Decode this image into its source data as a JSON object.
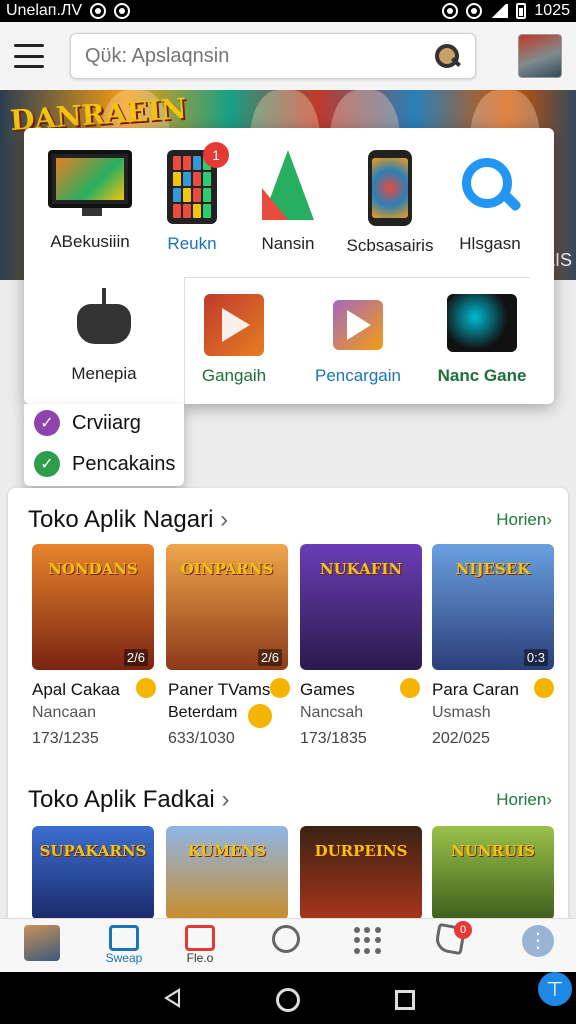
{
  "status_bar": {
    "carrier": "Unelaп.ЛV",
    "time": "1025"
  },
  "search": {
    "placeholder": "Qϋk: Apslaqnsin"
  },
  "banner": {
    "logo": "DANRAEIN",
    "side_text": "ΛIS"
  },
  "popup": {
    "items": [
      {
        "label": "ABekusiiin",
        "icon": "monitor-icon",
        "style": "normal"
      },
      {
        "label": "Reukn",
        "icon": "tablet-icon",
        "style": "blue",
        "badge": "1"
      },
      {
        "label": "Nansin",
        "icon": "triangle-logo-icon",
        "style": "normal"
      },
      {
        "label": "Scbsasairis",
        "icon": "phone-icon",
        "style": "normal"
      },
      {
        "label": "Hlsgasn",
        "icon": "search-icon",
        "style": "normal"
      },
      {
        "label": "Menepia",
        "icon": "gamepad-icon",
        "style": "normal"
      },
      {
        "label": "Gangaih",
        "icon": "play-store-icon",
        "style": "green"
      },
      {
        "label": "Pencargain",
        "icon": "play-gradient-icon",
        "style": "blue"
      },
      {
        "label": "Nanc Gane",
        "icon": "dark-game-icon",
        "style": "green"
      }
    ],
    "checks": [
      {
        "label": "Crviiarg",
        "color": "#8e44ad"
      },
      {
        "label": "Pencakains",
        "color": "#2e9d4a"
      }
    ]
  },
  "section1": {
    "title": "Toko Aplik Nagari",
    "link": "Horien",
    "apps": [
      {
        "tile_text": "NONDANS",
        "count": "2/6",
        "name": "Apal Cakaa",
        "sub": "Nancaan",
        "num": "173/1235",
        "bg": "#b9451d"
      },
      {
        "tile_text": "OINPARNS",
        "count": "2/6",
        "name": "Paner TVams",
        "sub": "Beterdam",
        "num": "633/1030",
        "bg": "#c0662a"
      },
      {
        "tile_text": "NUKAFIN",
        "count": "",
        "name": "Games",
        "sub": "Nancsah",
        "num": "173/1835",
        "bg": "#4a2a86"
      },
      {
        "tile_text": "NIJESEK",
        "count": "0:3",
        "name": "Para Caran",
        "sub": "Usmash",
        "num": "202/025",
        "bg": "#3f6cb3"
      }
    ]
  },
  "section2": {
    "title": "Toko Aplik Fadkai",
    "link": "Horien",
    "apps": [
      {
        "tile_text": "SUPAKARNS",
        "bg": "#2b4fa8"
      },
      {
        "tile_text": "KUMENS",
        "bg": "#d7a531"
      },
      {
        "tile_text": "DURPEINS",
        "bg": "#8b2a1a"
      },
      {
        "tile_text": "NUNRUIS",
        "bg": "#5c8a2a"
      }
    ]
  },
  "bottom_nav": [
    {
      "label": "",
      "icon": "game-avatar-icon"
    },
    {
      "label": "Sweap",
      "icon": "tv-icon"
    },
    {
      "label": "Fle.o",
      "icon": "video-icon"
    },
    {
      "label": "",
      "icon": "emoji-icon"
    },
    {
      "label": "",
      "icon": "apps-grid-icon"
    },
    {
      "label": "",
      "icon": "phone-icon",
      "badge": "0"
    },
    {
      "label": "",
      "icon": "more-icon"
    }
  ]
}
